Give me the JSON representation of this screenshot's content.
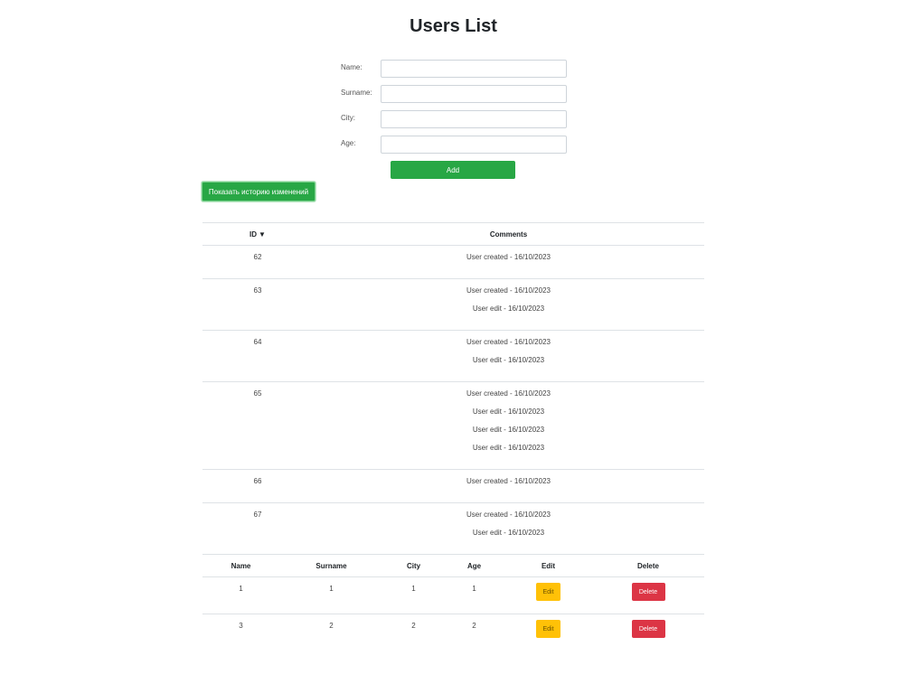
{
  "title": "Users List",
  "form": {
    "fields": [
      {
        "label": "Name:",
        "value": "",
        "placeholder": ""
      },
      {
        "label": "Surname:",
        "value": "",
        "placeholder": ""
      },
      {
        "label": "City:",
        "value": "",
        "placeholder": ""
      },
      {
        "label": "Age:",
        "value": "",
        "placeholder": ""
      }
    ],
    "add_label": "Add"
  },
  "history_button_label": "Показать историю изменений",
  "history": {
    "headers": {
      "id": "ID",
      "sort_indicator": "▼",
      "comments": "Comments"
    },
    "rows": [
      {
        "id": "62",
        "comments": [
          "User created - 16/10/2023"
        ]
      },
      {
        "id": "63",
        "comments": [
          "User created - 16/10/2023",
          "User edit - 16/10/2023"
        ]
      },
      {
        "id": "64",
        "comments": [
          "User created - 16/10/2023",
          "User edit - 16/10/2023"
        ]
      },
      {
        "id": "65",
        "comments": [
          "User created - 16/10/2023",
          "User edit - 16/10/2023",
          "User edit - 16/10/2023",
          "User edit - 16/10/2023"
        ]
      },
      {
        "id": "66",
        "comments": [
          "User created - 16/10/2023"
        ]
      },
      {
        "id": "67",
        "comments": [
          "User created - 16/10/2023",
          "User edit - 16/10/2023"
        ]
      }
    ]
  },
  "users": {
    "headers": {
      "name": "Name",
      "surname": "Surname",
      "city": "City",
      "age": "Age",
      "edit": "Edit",
      "delete": "Delete"
    },
    "rows": [
      {
        "name": "1",
        "surname": "1",
        "city": "1",
        "age": "1",
        "edit_label": "Edit",
        "delete_label": "Delete"
      },
      {
        "name": "3",
        "surname": "2",
        "city": "2",
        "age": "2",
        "edit_label": "Edit",
        "delete_label": "Delete"
      }
    ]
  },
  "colors": {
    "success": "#28a745",
    "warning": "#ffc107",
    "danger": "#dc3545",
    "border": "#dee2e6"
  }
}
